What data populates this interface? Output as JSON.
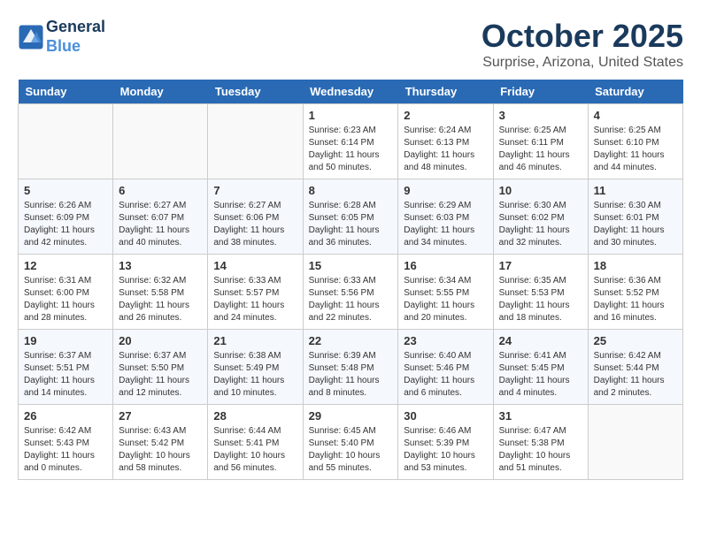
{
  "header": {
    "logo_line1": "General",
    "logo_line2": "Blue",
    "month": "October 2025",
    "location": "Surprise, Arizona, United States"
  },
  "days_of_week": [
    "Sunday",
    "Monday",
    "Tuesday",
    "Wednesday",
    "Thursday",
    "Friday",
    "Saturday"
  ],
  "weeks": [
    [
      {
        "day": "",
        "info": ""
      },
      {
        "day": "",
        "info": ""
      },
      {
        "day": "",
        "info": ""
      },
      {
        "day": "1",
        "info": "Sunrise: 6:23 AM\nSunset: 6:14 PM\nDaylight: 11 hours\nand 50 minutes."
      },
      {
        "day": "2",
        "info": "Sunrise: 6:24 AM\nSunset: 6:13 PM\nDaylight: 11 hours\nand 48 minutes."
      },
      {
        "day": "3",
        "info": "Sunrise: 6:25 AM\nSunset: 6:11 PM\nDaylight: 11 hours\nand 46 minutes."
      },
      {
        "day": "4",
        "info": "Sunrise: 6:25 AM\nSunset: 6:10 PM\nDaylight: 11 hours\nand 44 minutes."
      }
    ],
    [
      {
        "day": "5",
        "info": "Sunrise: 6:26 AM\nSunset: 6:09 PM\nDaylight: 11 hours\nand 42 minutes."
      },
      {
        "day": "6",
        "info": "Sunrise: 6:27 AM\nSunset: 6:07 PM\nDaylight: 11 hours\nand 40 minutes."
      },
      {
        "day": "7",
        "info": "Sunrise: 6:27 AM\nSunset: 6:06 PM\nDaylight: 11 hours\nand 38 minutes."
      },
      {
        "day": "8",
        "info": "Sunrise: 6:28 AM\nSunset: 6:05 PM\nDaylight: 11 hours\nand 36 minutes."
      },
      {
        "day": "9",
        "info": "Sunrise: 6:29 AM\nSunset: 6:03 PM\nDaylight: 11 hours\nand 34 minutes."
      },
      {
        "day": "10",
        "info": "Sunrise: 6:30 AM\nSunset: 6:02 PM\nDaylight: 11 hours\nand 32 minutes."
      },
      {
        "day": "11",
        "info": "Sunrise: 6:30 AM\nSunset: 6:01 PM\nDaylight: 11 hours\nand 30 minutes."
      }
    ],
    [
      {
        "day": "12",
        "info": "Sunrise: 6:31 AM\nSunset: 6:00 PM\nDaylight: 11 hours\nand 28 minutes."
      },
      {
        "day": "13",
        "info": "Sunrise: 6:32 AM\nSunset: 5:58 PM\nDaylight: 11 hours\nand 26 minutes."
      },
      {
        "day": "14",
        "info": "Sunrise: 6:33 AM\nSunset: 5:57 PM\nDaylight: 11 hours\nand 24 minutes."
      },
      {
        "day": "15",
        "info": "Sunrise: 6:33 AM\nSunset: 5:56 PM\nDaylight: 11 hours\nand 22 minutes."
      },
      {
        "day": "16",
        "info": "Sunrise: 6:34 AM\nSunset: 5:55 PM\nDaylight: 11 hours\nand 20 minutes."
      },
      {
        "day": "17",
        "info": "Sunrise: 6:35 AM\nSunset: 5:53 PM\nDaylight: 11 hours\nand 18 minutes."
      },
      {
        "day": "18",
        "info": "Sunrise: 6:36 AM\nSunset: 5:52 PM\nDaylight: 11 hours\nand 16 minutes."
      }
    ],
    [
      {
        "day": "19",
        "info": "Sunrise: 6:37 AM\nSunset: 5:51 PM\nDaylight: 11 hours\nand 14 minutes."
      },
      {
        "day": "20",
        "info": "Sunrise: 6:37 AM\nSunset: 5:50 PM\nDaylight: 11 hours\nand 12 minutes."
      },
      {
        "day": "21",
        "info": "Sunrise: 6:38 AM\nSunset: 5:49 PM\nDaylight: 11 hours\nand 10 minutes."
      },
      {
        "day": "22",
        "info": "Sunrise: 6:39 AM\nSunset: 5:48 PM\nDaylight: 11 hours\nand 8 minutes."
      },
      {
        "day": "23",
        "info": "Sunrise: 6:40 AM\nSunset: 5:46 PM\nDaylight: 11 hours\nand 6 minutes."
      },
      {
        "day": "24",
        "info": "Sunrise: 6:41 AM\nSunset: 5:45 PM\nDaylight: 11 hours\nand 4 minutes."
      },
      {
        "day": "25",
        "info": "Sunrise: 6:42 AM\nSunset: 5:44 PM\nDaylight: 11 hours\nand 2 minutes."
      }
    ],
    [
      {
        "day": "26",
        "info": "Sunrise: 6:42 AM\nSunset: 5:43 PM\nDaylight: 11 hours\nand 0 minutes."
      },
      {
        "day": "27",
        "info": "Sunrise: 6:43 AM\nSunset: 5:42 PM\nDaylight: 10 hours\nand 58 minutes."
      },
      {
        "day": "28",
        "info": "Sunrise: 6:44 AM\nSunset: 5:41 PM\nDaylight: 10 hours\nand 56 minutes."
      },
      {
        "day": "29",
        "info": "Sunrise: 6:45 AM\nSunset: 5:40 PM\nDaylight: 10 hours\nand 55 minutes."
      },
      {
        "day": "30",
        "info": "Sunrise: 6:46 AM\nSunset: 5:39 PM\nDaylight: 10 hours\nand 53 minutes."
      },
      {
        "day": "31",
        "info": "Sunrise: 6:47 AM\nSunset: 5:38 PM\nDaylight: 10 hours\nand 51 minutes."
      },
      {
        "day": "",
        "info": ""
      }
    ]
  ]
}
